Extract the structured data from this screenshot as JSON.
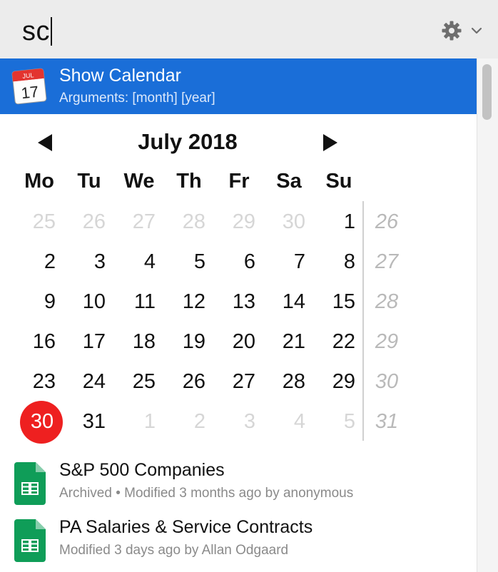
{
  "search": {
    "query": "sc"
  },
  "selected_result": {
    "title": "Show Calendar",
    "subtitle": "Arguments: [month] [year]",
    "icon": "calendar-app-icon",
    "icon_month": "JUL",
    "icon_day": "17"
  },
  "calendar": {
    "title": "July 2018",
    "weekdays": [
      "Mo",
      "Tu",
      "We",
      "Th",
      "Fr",
      "Sa",
      "Su"
    ],
    "today": "30",
    "weeks": [
      {
        "days": [
          "25",
          "26",
          "27",
          "28",
          "29",
          "30",
          "1"
        ],
        "muted": [
          true,
          true,
          true,
          true,
          true,
          true,
          false
        ],
        "week_number": "26"
      },
      {
        "days": [
          "2",
          "3",
          "4",
          "5",
          "6",
          "7",
          "8"
        ],
        "muted": [
          false,
          false,
          false,
          false,
          false,
          false,
          false
        ],
        "week_number": "27"
      },
      {
        "days": [
          "9",
          "10",
          "11",
          "12",
          "13",
          "14",
          "15"
        ],
        "muted": [
          false,
          false,
          false,
          false,
          false,
          false,
          false
        ],
        "week_number": "28"
      },
      {
        "days": [
          "16",
          "17",
          "18",
          "19",
          "20",
          "21",
          "22"
        ],
        "muted": [
          false,
          false,
          false,
          false,
          false,
          false,
          false
        ],
        "week_number": "29"
      },
      {
        "days": [
          "23",
          "24",
          "25",
          "26",
          "27",
          "28",
          "29"
        ],
        "muted": [
          false,
          false,
          false,
          false,
          false,
          false,
          false
        ],
        "week_number": "30"
      },
      {
        "days": [
          "30",
          "31",
          "1",
          "2",
          "3",
          "4",
          "5"
        ],
        "muted": [
          false,
          false,
          true,
          true,
          true,
          true,
          true
        ],
        "week_number": "31"
      }
    ]
  },
  "results": [
    {
      "title": "S&P 500 Companies",
      "subtitle": "Archived • Modified 3 months ago by anonymous",
      "icon": "google-sheets-icon"
    },
    {
      "title": "PA Salaries & Service Contracts",
      "subtitle": "Modified 3 days ago by Allan Odgaard",
      "icon": "google-sheets-icon"
    }
  ],
  "colors": {
    "accent": "#1a6ed8",
    "today": "#ee2020",
    "sheets_green": "#0f9d58"
  }
}
